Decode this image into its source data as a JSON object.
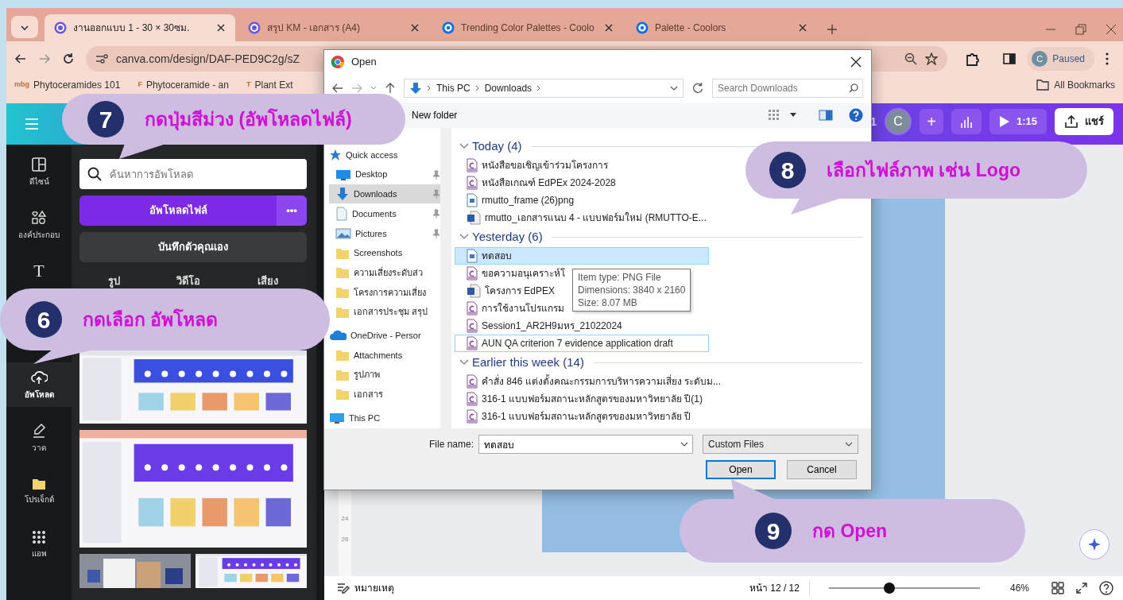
{
  "browser": {
    "tabs": [
      {
        "title": "งานออกแบบ 1 - 30 × 30ซม.",
        "kind": "canva",
        "selected": true
      },
      {
        "title": "สรุป KM - เอกสาร (A4)",
        "kind": "canva",
        "selected": false
      },
      {
        "title": "Trending Color Palettes - Coolo",
        "kind": "coolors",
        "selected": false
      },
      {
        "title": "Palette - Coolors",
        "kind": "coolors",
        "selected": false
      }
    ],
    "address": "canva.com/design/DAF-PED9C2g/sZ",
    "profile": {
      "initial": "C",
      "label": "Paused"
    },
    "bookmarks": [
      {
        "badge": "mbg",
        "label": "Phytoceramides 101"
      },
      {
        "badge": "F",
        "label": "Phytoceramide - an"
      },
      {
        "badge": "T",
        "label": "Plant Ext"
      }
    ],
    "all_bookmarks": "All Bookmarks"
  },
  "canva": {
    "header": {
      "page_count": "1",
      "avatar": "C",
      "plus": "+",
      "time": "1:15",
      "share": "แชร์"
    },
    "rail": [
      {
        "kind": "layout",
        "label": "ดีไซน์",
        "selected": false
      },
      {
        "kind": "shapes",
        "label": "องค์ประกอบ",
        "selected": false
      },
      {
        "kind": "text",
        "glyph": "T",
        "selected": false
      },
      {
        "kind": "upload",
        "label": "อัพโหลด",
        "selected": true
      },
      {
        "kind": "draw",
        "label": "วาด",
        "selected": false
      },
      {
        "kind": "folder",
        "label": "โปรเจ็กต์",
        "selected": false
      },
      {
        "kind": "apps",
        "label": "แอพ",
        "selected": false
      }
    ],
    "panel": {
      "search_placeholder": "ค้นหาการอัพโหลด",
      "upload_button": "อัพโหลดไฟล์",
      "more": "•••",
      "record_button": "บันทึกตัวคุณเอง",
      "tabs": [
        {
          "label": "รูป"
        },
        {
          "label": "วิดีโอ"
        },
        {
          "label": "เสียง"
        }
      ]
    },
    "ruler": [
      "24",
      "26"
    ],
    "bottom": {
      "notes": "หมายเหตุ",
      "page": "หน้า 12 / 12",
      "zoom": {
        "level": 0.4
      },
      "zoom_reading": "46%"
    }
  },
  "dialog": {
    "title": "Open",
    "path": [
      "This PC",
      "Downloads"
    ],
    "search_placeholder": "Search Downloads",
    "new_folder": "New folder",
    "nav": [
      {
        "label": "Quick access",
        "kind": "star",
        "pinned": false,
        "selected": false
      },
      {
        "label": "Desktop",
        "kind": "desktop",
        "pinned": true,
        "selected": false
      },
      {
        "label": "Downloads",
        "kind": "download",
        "pinned": true,
        "selected": true
      },
      {
        "label": "Documents",
        "kind": "documents",
        "pinned": true,
        "selected": false
      },
      {
        "label": "Pictures",
        "kind": "pictures",
        "pinned": true,
        "selected": false
      },
      {
        "label": "Screenshots",
        "kind": "folder",
        "pinned": false,
        "selected": false
      },
      {
        "label": "ความเสี่ยงระดับส่ว",
        "kind": "folder",
        "pinned": false,
        "selected": false
      },
      {
        "label": "โครงการความเสี่ยง",
        "kind": "folder",
        "pinned": false,
        "selected": false
      },
      {
        "label": "เอกสารประชุม สรุป",
        "kind": "folder",
        "pinned": false,
        "selected": false
      },
      {
        "label": "OneDrive - Persor",
        "kind": "cloud",
        "pinned": false,
        "selected": false
      },
      {
        "label": "Attachments",
        "kind": "folder",
        "pinned": false,
        "selected": false
      },
      {
        "label": "รูปภาพ",
        "kind": "folder",
        "pinned": false,
        "selected": false
      },
      {
        "label": "เอกสาร",
        "kind": "folder",
        "pinned": false,
        "selected": false
      },
      {
        "label": "This PC",
        "kind": "pc",
        "pinned": false,
        "selected": false
      }
    ],
    "groups": [
      {
        "title": "Today (4)",
        "files": [
          {
            "name": "หนังสือขอเชิญเข้าร่วมโครงการ",
            "kind": "pdf",
            "selected": false,
            "focused": false
          },
          {
            "name": "หนังสือเกณฑ์ EdPEx 2024-2028",
            "kind": "pdf",
            "selected": false,
            "focused": false
          },
          {
            "name": "rmutto_frame (26)png",
            "kind": "png",
            "selected": false,
            "focused": false
          },
          {
            "name": "rmutto_เอกสารแนบ 4 - แบบฟอร์มใหม่ (RMUTTO-E...",
            "kind": "word",
            "selected": false,
            "focused": false
          }
        ]
      },
      {
        "title": "Yesterday (6)",
        "files": [
          {
            "name": "ทดสอบ",
            "kind": "png",
            "selected": true,
            "focused": false
          },
          {
            "name": "ขอความอนุเคราะห์โ",
            "kind": "pdf",
            "selected": false,
            "focused": false
          },
          {
            "name": "โครงการ EdPEX",
            "kind": "word",
            "selected": false,
            "focused": false
          },
          {
            "name": "การใช้งานโปรแกรม",
            "kind": "pdf",
            "selected": false,
            "focused": false
          },
          {
            "name": "Session1_AR2H9มหร_21022024",
            "kind": "pdf",
            "selected": false,
            "focused": false
          },
          {
            "name": "AUN QA criterion 7 evidence application draft",
            "kind": "pdf",
            "selected": false,
            "focused": true
          }
        ]
      },
      {
        "title": "Earlier this week (14)",
        "files": [
          {
            "name": "คำสั่ง 846 แต่งตั้งคณะกรรมการบริหารความเสี่ยง ระดับม...",
            "kind": "pdf",
            "selected": false,
            "focused": false
          },
          {
            "name": "316-1 แบบฟอร์มสถานะหลักสูตรของมหาวิทยาลัย ปี(1)",
            "kind": "pdf",
            "selected": false,
            "focused": false
          },
          {
            "name": "316-1 แบบฟอร์มสถานะหลักสูตรของมหาวิทยาลัย ปี",
            "kind": "pdf",
            "selected": false,
            "focused": false
          }
        ]
      }
    ],
    "tooltip": [
      "Item type: PNG File",
      "Dimensions: 3840 x 2160",
      "Size: 8.07 MB"
    ],
    "file_name_label": "File name:",
    "file_name": "ทดสอบ",
    "filter": "Custom Files",
    "buttons": [
      "Open",
      "Cancel"
    ]
  },
  "callouts": [
    {
      "number": "7",
      "text": "กดปุ่มสีม่วง (อัพโหลดไฟล์)"
    },
    {
      "number": "8",
      "text": "เลือกไฟล์ภาพ เช่น Logo"
    },
    {
      "number": "6",
      "text": "กดเลือก อัพโหลด"
    },
    {
      "number": "9",
      "text": "กด Open"
    }
  ]
}
